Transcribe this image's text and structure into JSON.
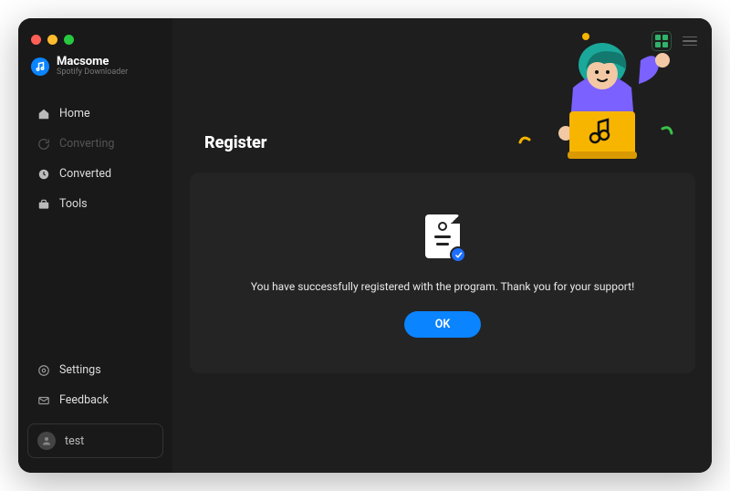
{
  "brand": {
    "name": "Macsome",
    "subtitle": "Spotify Downloader"
  },
  "sidebar": {
    "items": [
      {
        "label": "Home"
      },
      {
        "label": "Converting"
      },
      {
        "label": "Converted"
      },
      {
        "label": "Tools"
      }
    ],
    "bottom": [
      {
        "label": "Settings"
      },
      {
        "label": "Feedback"
      }
    ],
    "user": {
      "name": "test"
    }
  },
  "page": {
    "title": "Register"
  },
  "dialog": {
    "message": "You have successfully registered with the program. Thank you for your support!",
    "ok_label": "OK"
  }
}
